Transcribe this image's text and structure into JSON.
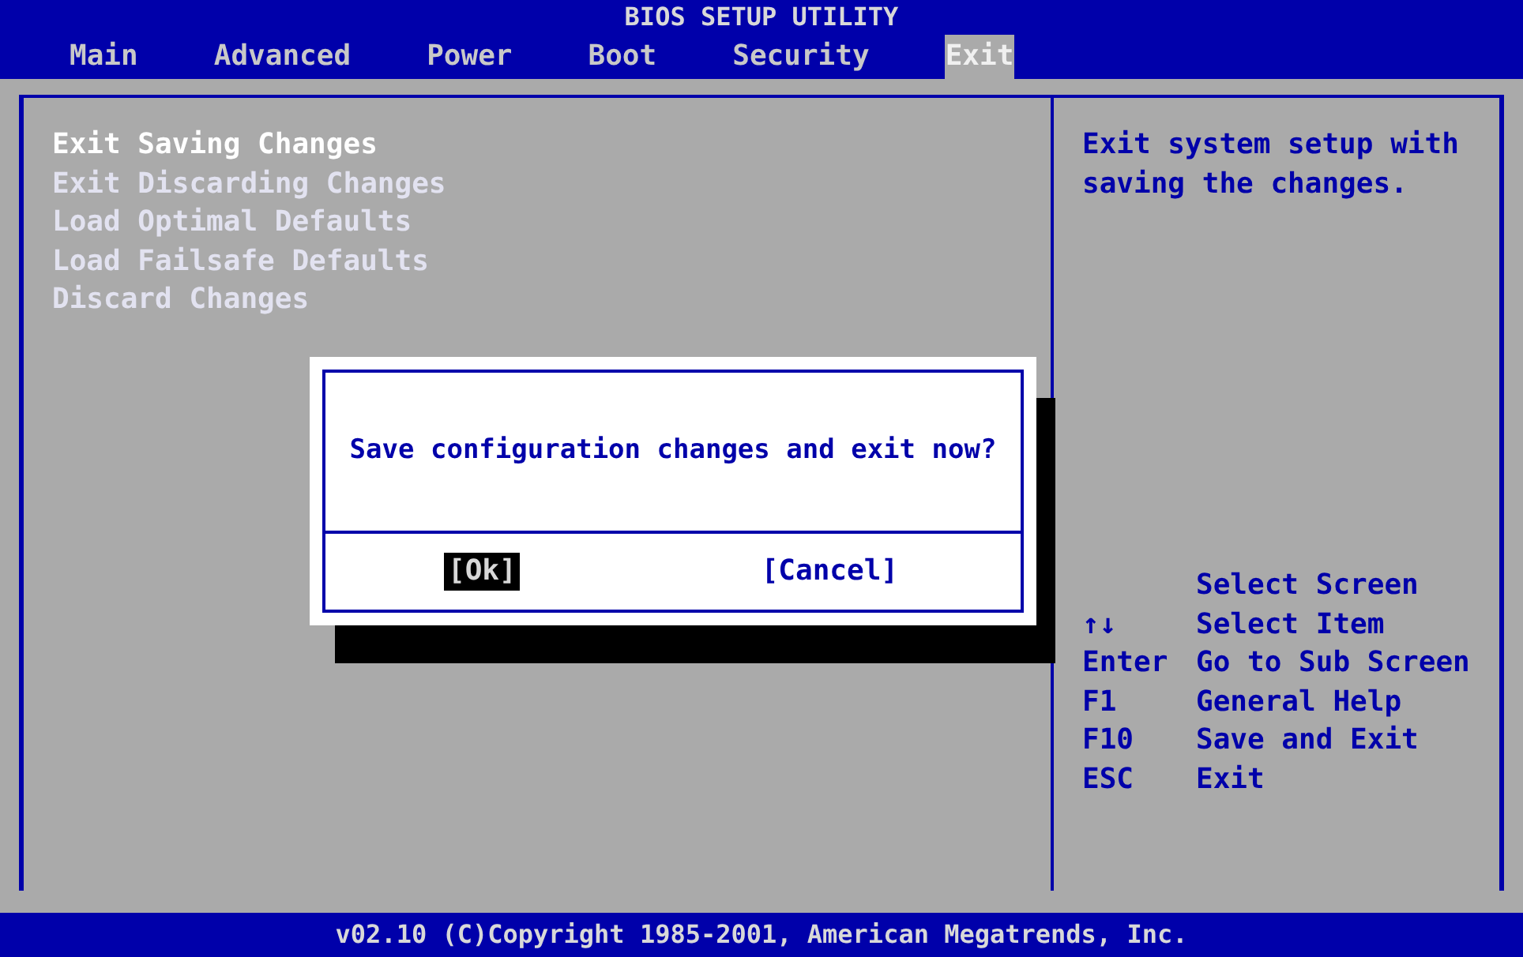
{
  "title": "BIOS SETUP UTILITY",
  "tabs": [
    {
      "label": "Main",
      "selected": false
    },
    {
      "label": "Advanced",
      "selected": false
    },
    {
      "label": "Power",
      "selected": false
    },
    {
      "label": "Boot",
      "selected": false
    },
    {
      "label": "Security",
      "selected": false
    },
    {
      "label": "Exit",
      "selected": true
    }
  ],
  "menu_items": [
    {
      "label": "Exit Saving Changes",
      "selected": true
    },
    {
      "label": "Exit Discarding Changes",
      "selected": false
    },
    {
      "label": "Load Optimal Defaults",
      "selected": false
    },
    {
      "label": "Load Failsafe Defaults",
      "selected": false
    },
    {
      "label": "Discard Changes",
      "selected": false
    }
  ],
  "help_text": "Exit system setup with saving the changes.",
  "legend": [
    {
      "action": "Select Screen"
    },
    {
      "key": "↑↓",
      "action": "Select Item"
    },
    {
      "key": "Enter",
      "action": "Go to Sub Screen"
    },
    {
      "key": "F1",
      "action": "General Help"
    },
    {
      "key": "F10",
      "action": "Save and Exit"
    },
    {
      "key": "ESC",
      "action": "Exit"
    }
  ],
  "dialog": {
    "message": "Save configuration changes and exit now?",
    "buttons": [
      {
        "label": "[Ok]",
        "selected": true
      },
      {
        "label": "[Cancel]",
        "selected": false
      }
    ]
  },
  "footer": "v02.10 (C)Copyright 1985-2001, American Megatrends, Inc."
}
